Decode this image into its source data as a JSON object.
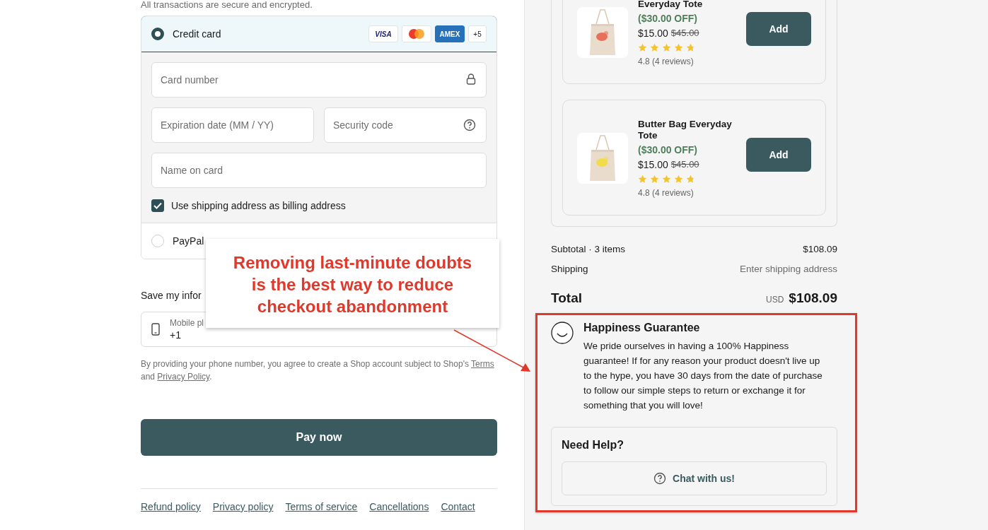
{
  "payment": {
    "note": "All transactions are secure and encrypted.",
    "methods": [
      {
        "kind": "card",
        "label": "Credit card",
        "selected": true,
        "badges": [
          {
            "kind": "visa",
            "text": "VISA"
          },
          {
            "kind": "mastercard"
          },
          {
            "kind": "amex",
            "text": "AMEX"
          },
          {
            "kind": "more",
            "text": "+5"
          }
        ],
        "field_rows": [
          [
            {
              "kind": "lock",
              "placeholder": "Card number"
            }
          ],
          [
            {
              "kind": "plain",
              "placeholder": "Expiration date (MM / YY)"
            },
            {
              "kind": "help",
              "placeholder": "Security code"
            }
          ],
          [
            {
              "kind": "plain",
              "placeholder": "Name on card"
            }
          ]
        ],
        "billing_checkbox": {
          "label": "Use shipping address as billing address",
          "checked": true
        }
      },
      {
        "kind": "paypal",
        "label": "PayPal",
        "selected": false
      }
    ]
  },
  "save_info": {
    "label": "Save my infor",
    "phone_field": {
      "label": "Mobile pl",
      "value": "+1"
    }
  },
  "legal": [
    {
      "kind": "text",
      "text": "By providing your phone number, you agree to create a Shop account subject to Shop's "
    },
    {
      "kind": "link",
      "text": "Terms"
    },
    {
      "kind": "text",
      "text": " and "
    },
    {
      "kind": "link",
      "text": "Privacy Policy"
    },
    {
      "kind": "text",
      "text": "."
    }
  ],
  "pay_button": "Pay now",
  "footer_links": [
    "Refund policy",
    "Privacy policy",
    "Terms of service",
    "Cancellations",
    "Contact"
  ],
  "upsell": [
    {
      "name": "Everyday Tote",
      "discount": "($30.00 OFF)",
      "price": "$15.00",
      "old_price": "$45.00",
      "stars": 4.8,
      "reviews": "4.8 (4 reviews)",
      "button": "Add"
    },
    {
      "name": "Butter Bag Everyday Tote",
      "discount": "($30.00 OFF)",
      "price": "$15.00",
      "old_price": "$45.00",
      "stars": 4.8,
      "reviews": "4.8 (4 reviews)",
      "button": "Add"
    }
  ],
  "summary": [
    {
      "label": "Subtotal · 3 items",
      "value": "$108.09",
      "kind": "value"
    },
    {
      "label": "Shipping",
      "value": "Enter shipping address",
      "kind": "hint"
    }
  ],
  "total": {
    "label": "Total",
    "currency": "USD",
    "value": "$108.09"
  },
  "guarantee": {
    "title": "Happiness Guarantee",
    "text": "We pride ourselves in having a 100% Happiness guarantee! If for any reason your product doesn't live up to the hype, you have 30 days from the date of purchase to follow our simple steps to return or exchange it for something that you will love!"
  },
  "help": {
    "title": "Need Help?",
    "button": "Chat with us!"
  },
  "annotation": {
    "callout": "Removing last-minute doubts\nis the best way to reduce\ncheckout abandonment"
  }
}
